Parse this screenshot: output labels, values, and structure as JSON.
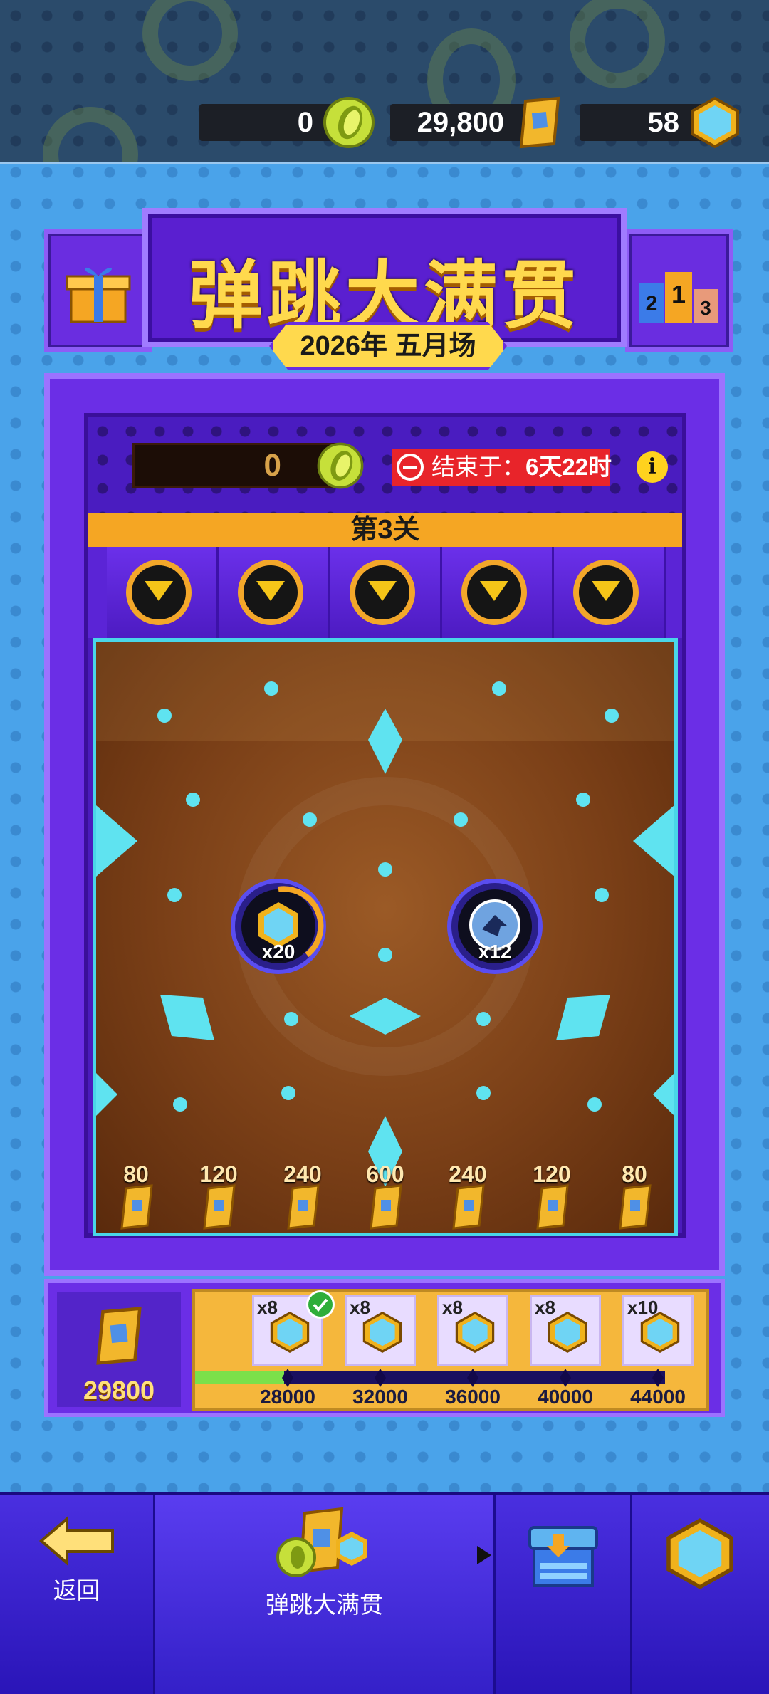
{
  "currencies": [
    {
      "value": "0",
      "icon": "coin-icon"
    },
    {
      "value": "29,800",
      "icon": "ticket-icon"
    },
    {
      "value": "58",
      "icon": "gem-icon"
    }
  ],
  "title": {
    "main": "弹跳大满贯",
    "subtitle": "2026年 五月场"
  },
  "machine": {
    "score": "0",
    "ends_label": "结束于：",
    "ends_value": "6天22时",
    "info_label": "i",
    "level": "第3关",
    "multipliers": [
      "x20",
      "x12"
    ],
    "slots": [
      "80",
      "120",
      "240",
      "600",
      "240",
      "120",
      "80"
    ]
  },
  "progress": {
    "total": "29800",
    "rewards": [
      {
        "count": "x8",
        "threshold": "28000",
        "claimed": true
      },
      {
        "count": "x8",
        "threshold": "32000",
        "claimed": false
      },
      {
        "count": "x8",
        "threshold": "36000",
        "claimed": false
      },
      {
        "count": "x8",
        "threshold": "40000",
        "claimed": false
      },
      {
        "count": "x10",
        "threshold": "44000",
        "claimed": false
      }
    ],
    "fill_fraction": 0.19
  },
  "nav": {
    "back": "返回",
    "event": "弹跳大满贯"
  },
  "colors": {
    "accent_purple": "#6b2ee6",
    "gold": "#ffd94d",
    "cyan": "#5fe3f0",
    "red": "#e8242a"
  }
}
